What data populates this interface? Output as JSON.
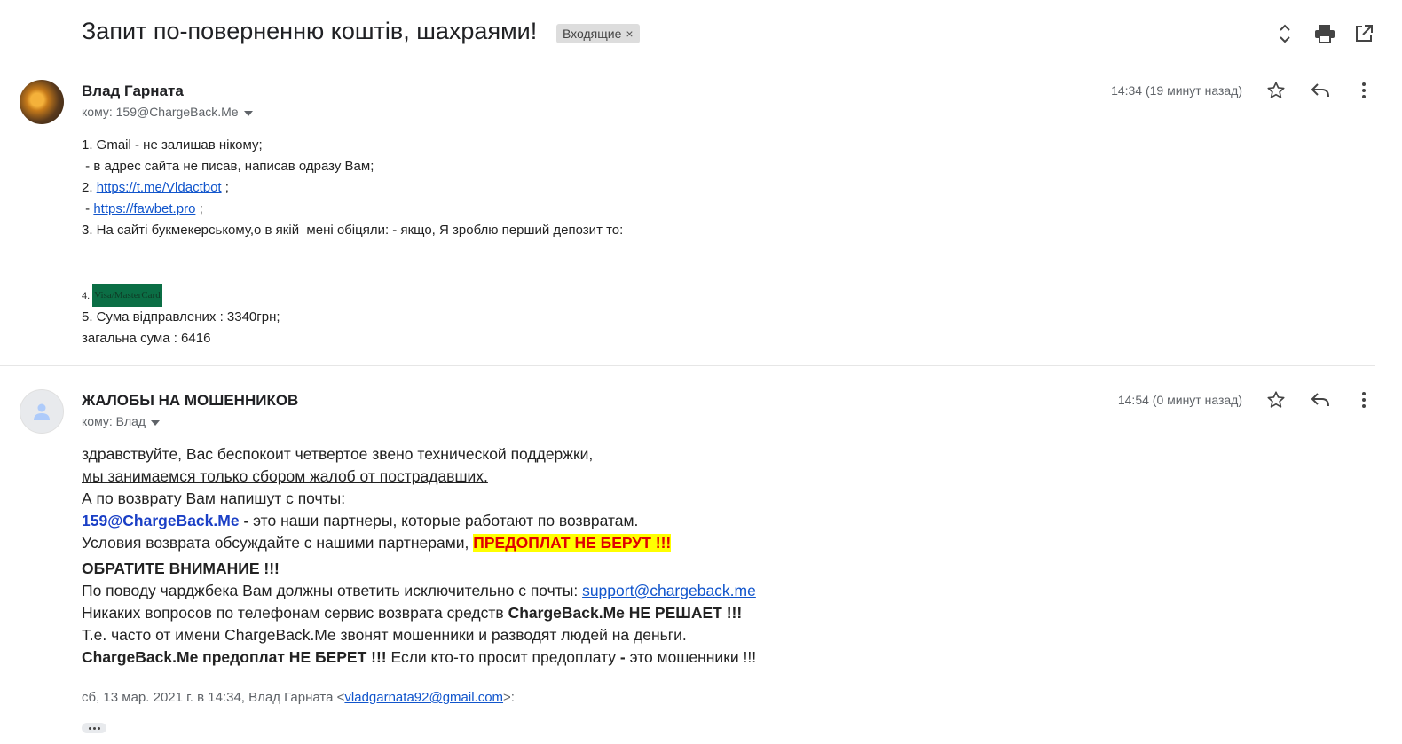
{
  "header": {
    "subject": "Запит по-поверненню коштів, шахраями!",
    "label": "Входящие",
    "label_close": "×",
    "icons": [
      "expand-collapse-icon",
      "print-icon",
      "open-new-window-icon"
    ]
  },
  "messages": [
    {
      "sender": "Влад Гарната",
      "to": "кому: 159@ChargeBack.Me",
      "time": "14:34 (19 минут назад)",
      "lines": {
        "l1": "1. Gmail - не залишав нікому;",
        "l2": " - в адрес сайта не писав, написав одразу Вам;",
        "l3_prefix": "2. ",
        "l3_link": "https://t.me/Vldactbot",
        "l3_suffix": " ;",
        "l4_prefix": " - ",
        "l4_link": "https://fawbet.pro",
        "l4_suffix": " ;",
        "l5": "3. На сайті букмекерському,о в якій  мені обіцяли: - якщо, Я зроблю перший депозит то:",
        "l6_prefix": "4. ",
        "l6_card": "Visa/MasterCard",
        "l7": "5. Сума відправлених : 3340грн;",
        "l8": "загальна сума : 6416"
      }
    },
    {
      "sender": "ЖАЛОБЫ НА МОШЕННИКОВ",
      "to": "кому: Влад",
      "time": "14:54 (0 минут назад)",
      "lines": {
        "l1": "здравствуйте, Вас беспокоит четвертое звено технической поддержки,",
        "l2": "мы занимаемся только сбором жалоб от пострадавших.",
        "l3": "А по возврату Вам напишут с почты:",
        "l4_email": "159@ChargeBack.Me",
        "l4_dash": " - ",
        "l4_rest": "это наши партнеры, которые работают по возвратам.",
        "l5_prefix": "Условия возврата обсуждайте с нашими партнерами, ",
        "l5_warn": "ПРЕДОПЛАТ НЕ БЕРУТ !!!",
        "l6": "ОБРАТИТЕ ВНИМАНИЕ !!!",
        "l7_prefix": "По поводу чарджбека Вам должны ответить исключительно с почты: ",
        "l7_link": "support@chargeback.me",
        "l8_prefix": "Никаких вопросов по телефонам сервис возврата средств ",
        "l8_bold": "ChargeBack.Me НЕ РЕШАЕТ !!!",
        "l9": "Т.е. часто от имени ChargeBack.Me звонят мошенники и разводят людей на деньги.",
        "l10_bold": "ChargeBack.Me предоплат НЕ БЕРЕТ !!!",
        "l10_mid": " Если кто-то просит предоплату ",
        "l10_dash": "-",
        "l10_rest": " это мошенники !!!"
      },
      "quote": {
        "prefix": "сб, 13 мар. 2021 г. в 14:34, Влад Гарната <",
        "email": "vladgarnata92@gmail.com",
        "suffix": ">:"
      }
    }
  ],
  "colors": {
    "link": "#1155cc",
    "partner_email": "#1a3fc6",
    "warning_bg": "#ffff00",
    "warning_text": "#e00000",
    "card_bg": "#0b6e45"
  }
}
